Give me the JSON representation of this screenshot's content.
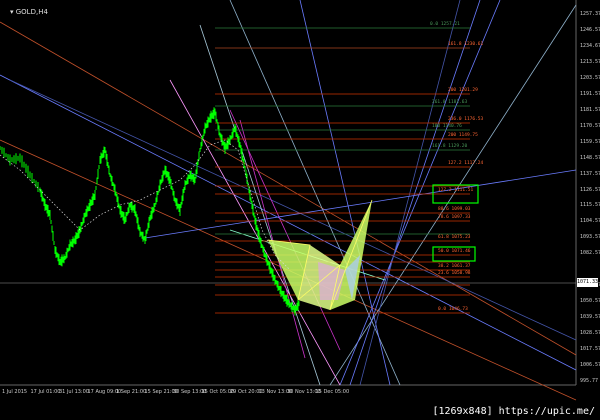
{
  "window": {
    "symbol_label": "▾ GOLD,H4",
    "current_price": "1071.33",
    "watermark": "[1269x848] https://upic.me/"
  },
  "price_axis": {
    "labels": [
      "1257.37",
      "1246.57",
      "1234.67",
      "1213.57",
      "1203.57",
      "1191.57",
      "1181.57",
      "1170.57",
      "1159.57",
      "1148.57",
      "1137.57",
      "1126.57",
      "1115.57",
      "1104.57",
      "1093.57",
      "1082.57",
      "1071.33",
      "1061.57",
      "1050.57",
      "1039.57",
      "1028.57",
      "1017.57",
      "1006.57",
      "995.77"
    ]
  },
  "time_axis": {
    "labels": [
      "1 Jul 2015",
      "17 Jul 01:00",
      "31 Jul 13:00",
      "17 Aug 09:00",
      "1 Sep 21:00",
      "15 Sep 21:00",
      "30 Sep 13:00",
      "15 Oct 05:00",
      "29 Oct 20:00",
      "13 Nov 13:00",
      "30 Nov 13:00",
      "15 Dec 05:00"
    ]
  },
  "fib_labels": [
    "0.0 1257.21",
    "161.8 1230.61",
    "200 1201.29",
    "261.8 1181.63",
    "236.0 1176.53",
    "100 1140.76",
    "200 1149.75",
    "161.8 1129.20",
    "127.2 1117.24",
    "127.2 1111.51",
    "88.6 1099.03",
    "78.6 1097.33",
    "61.8 1075.23",
    "50.0 1071.46",
    "38.2 1061.37",
    "23.6 1050.98",
    "0.0 1046.73"
  ],
  "colors": {
    "candles": "#00ff00",
    "fib_levels": "#ff3300",
    "trend_lines": "#6a7cff",
    "magenta_lines": "#cc33cc",
    "pattern_fill": "#ccff66",
    "highlight_box": "#00ff00"
  }
}
